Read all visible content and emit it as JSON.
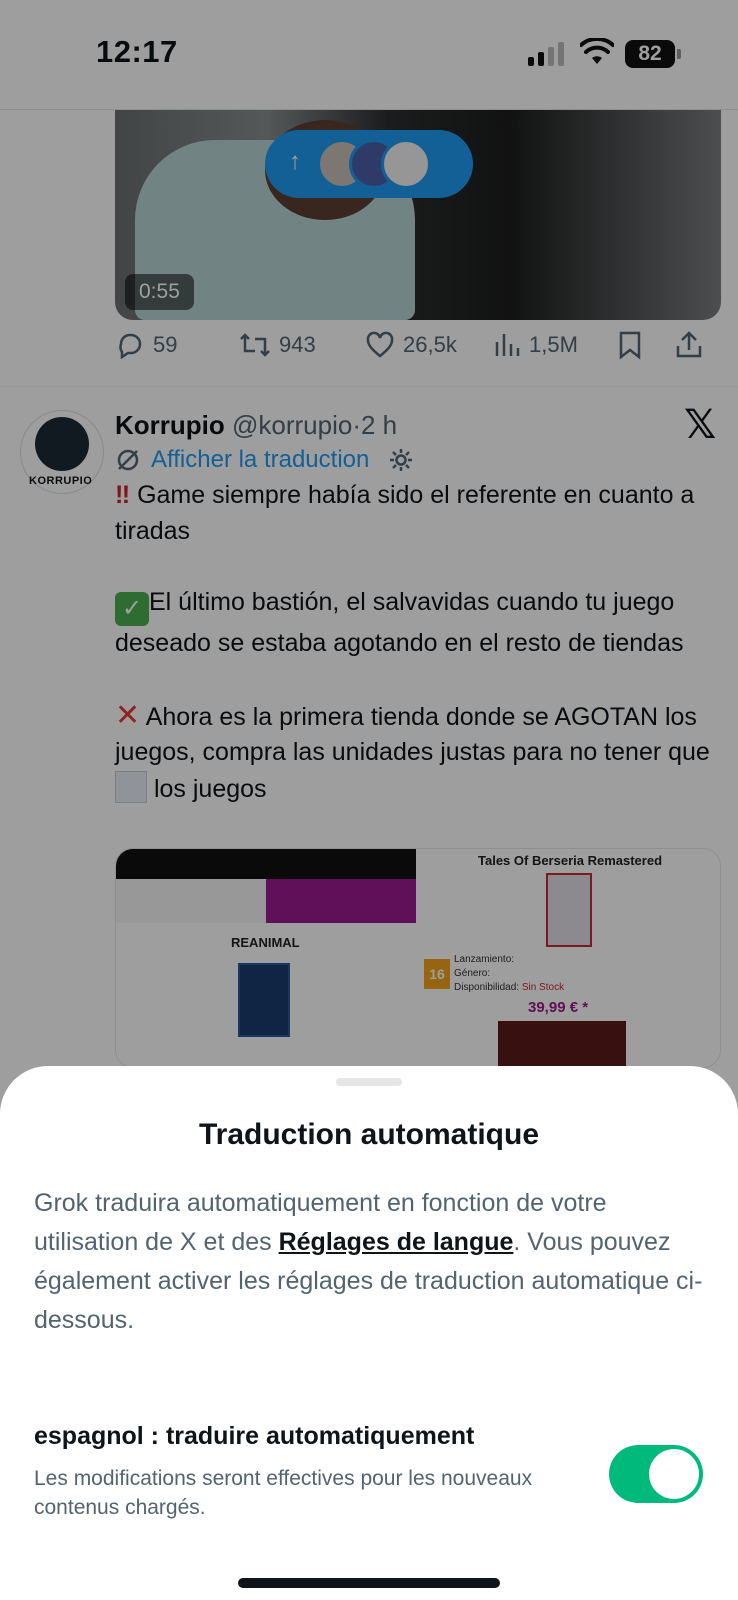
{
  "status_bar": {
    "time": "12:17",
    "battery": "82"
  },
  "video": {
    "duration": "0:55"
  },
  "prev_tweet_actions": {
    "replies": "59",
    "retweets": "943",
    "likes": "26,5k",
    "views": "1,5M"
  },
  "tweet": {
    "name": "Korrupio",
    "handle": "@korrupio",
    "sep": "·",
    "age": "2 h",
    "avatar_text": "KORRUPIO",
    "translate_label": "Afficher la traduction",
    "paragraph1": "Game siempre había sido el referente en cuanto a tiradas",
    "paragraph2": "El último bastión, el salvavidas cuando tu juego deseado se estaba agotando en el resto de tiendas",
    "paragraph3a": "Ahora es la primera tienda donde se AGOTAN los juegos, compra las unidades justas para no tener que",
    "paragraph3b": "los juegos"
  },
  "media": {
    "left_title": "REANIMAL",
    "right_title": "Tales Of Berseria Remastered",
    "pegi": "16",
    "launch_label": "Lanzamiento:",
    "genre_label": "Género:",
    "availability_label": "Disponibilidad:",
    "availability_value": "Sin Stock",
    "price": "39,99 € *"
  },
  "sheet": {
    "title": "Traduction automatique",
    "desc_before": "Grok traduira automatiquement en fonction de votre utilisation de X et des ",
    "desc_link": "Réglages de langue",
    "desc_after": ". Vous pouvez également activer les réglages de traduction automatique ci-dessous.",
    "row_title": "espagnol : traduire automatiquement",
    "row_sub": "Les modifications seront effectives pour les nouveaux contenus chargés.",
    "toggle_on": true
  }
}
